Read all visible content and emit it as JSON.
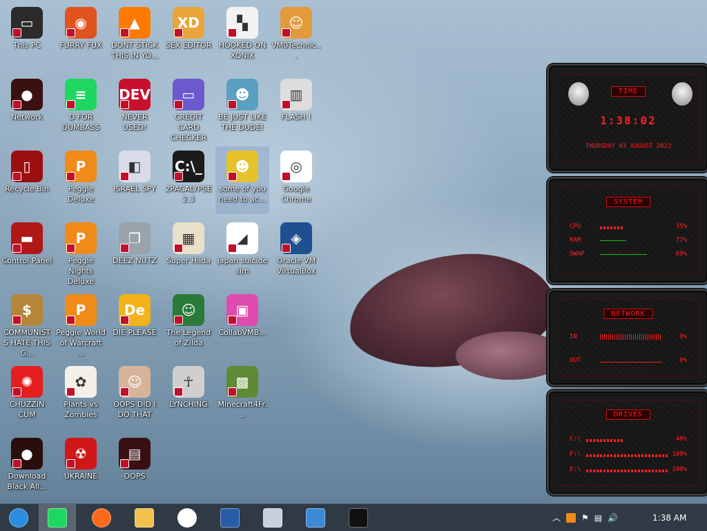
{
  "desktop": {
    "icons": [
      {
        "label": "This PC",
        "col": 0,
        "row": 0,
        "color": "#2b2b2b",
        "glyph": "▭"
      },
      {
        "label": "FURRY FUX",
        "col": 1,
        "row": 0,
        "color": "#e0531f",
        "glyph": "◉"
      },
      {
        "label": "DONT STICK THIS IN YO...",
        "col": 2,
        "row": 0,
        "color": "#ff7a00",
        "glyph": "▲"
      },
      {
        "label": "SEX EDITOR",
        "col": 3,
        "row": 0,
        "color": "#e9a53b",
        "glyph": "XD"
      },
      {
        "label": "HOOKED ON XONIX",
        "col": 4,
        "row": 0,
        "color": "#f2f2f2",
        "glyph": "▚"
      },
      {
        "label": "VM0Technic...",
        "col": 5,
        "row": 0,
        "color": "#e39a3b",
        "glyph": "☺"
      },
      {
        "label": "Network",
        "col": 0,
        "row": 1,
        "color": "#3a1010",
        "glyph": "●"
      },
      {
        "label": "D FOR DUMBASS",
        "col": 1,
        "row": 1,
        "color": "#1ed760",
        "glyph": "≡"
      },
      {
        "label": "NEVER USED!",
        "col": 2,
        "row": 1,
        "color": "#c8102e",
        "glyph": "DEV"
      },
      {
        "label": "CREDIT CARD CHECKER",
        "col": 3,
        "row": 1,
        "color": "#6a5acd",
        "glyph": "▭"
      },
      {
        "label": "BE JUST LIKE THE DUDE!",
        "col": 4,
        "row": 1,
        "color": "#5aa0c0",
        "glyph": "☻"
      },
      {
        "label": "FLASH !",
        "col": 5,
        "row": 1,
        "color": "#dddddd",
        "glyph": "▥"
      },
      {
        "label": "Recycle Bin",
        "col": 0,
        "row": 2,
        "color": "#9a1010",
        "glyph": "▯"
      },
      {
        "label": "Peggle Deluxe",
        "col": 1,
        "row": 2,
        "color": "#f08a18",
        "glyph": "P"
      },
      {
        "label": "ISRAEL SPY",
        "col": 2,
        "row": 2,
        "color": "#d8dce8",
        "glyph": "◧"
      },
      {
        "label": "2PACALYPSE 2.3",
        "col": 3,
        "row": 2,
        "color": "#1b1b1b",
        "glyph": "C:\\_"
      },
      {
        "label": "some of you need to ac...",
        "col": 4,
        "row": 2,
        "color": "#e8c22a",
        "glyph": "☻",
        "selected": true
      },
      {
        "label": "Google Chrome",
        "col": 5,
        "row": 2,
        "color": "#ffffff",
        "glyph": "◎"
      },
      {
        "label": "Control Panel",
        "col": 0,
        "row": 3,
        "color": "#b01818",
        "glyph": "▬"
      },
      {
        "label": "Peggle Nights Deluxe",
        "col": 1,
        "row": 3,
        "color": "#f08a18",
        "glyph": "P"
      },
      {
        "label": "DEEZ NUTZ",
        "col": 2,
        "row": 3,
        "color": "#9aa2aa",
        "glyph": "❐"
      },
      {
        "label": "Super Hilda",
        "col": 3,
        "row": 3,
        "color": "#e8e0c8",
        "glyph": "▦"
      },
      {
        "label": "japan suicide sim",
        "col": 4,
        "row": 3,
        "color": "#ffffff",
        "glyph": "◢"
      },
      {
        "label": "Oracle VM VirtualBox",
        "col": 5,
        "row": 3,
        "color": "#1f4f8f",
        "glyph": "◈"
      },
      {
        "label": "COMMUNISTS HATE THIS G...",
        "col": 0,
        "row": 4,
        "color": "#b5863a",
        "glyph": "$"
      },
      {
        "label": "Peggle World of Warcraft ...",
        "col": 1,
        "row": 4,
        "color": "#f08a18",
        "glyph": "P"
      },
      {
        "label": "DIE PLEASE",
        "col": 2,
        "row": 4,
        "color": "#f2b21a",
        "glyph": "De"
      },
      {
        "label": "The Legend of Zilda",
        "col": 3,
        "row": 4,
        "color": "#2a7a3a",
        "glyph": "☺"
      },
      {
        "label": "CollabVMB...",
        "col": 4,
        "row": 4,
        "color": "#e04bb0",
        "glyph": "▣"
      },
      {
        "label": "CHUZZIN CUM",
        "col": 0,
        "row": 5,
        "color": "#e51f1f",
        "glyph": "✺"
      },
      {
        "label": "Plants vs Zombies",
        "col": 1,
        "row": 5,
        "color": "#f4f0e8",
        "glyph": "✿"
      },
      {
        "label": "OOPS DID I DO THAT",
        "col": 2,
        "row": 5,
        "color": "#d6b49a",
        "glyph": "☺"
      },
      {
        "label": "LYNCHING",
        "col": 3,
        "row": 5,
        "color": "#cfcfcf",
        "glyph": "☥"
      },
      {
        "label": "Minecraft4Fr...",
        "col": 4,
        "row": 5,
        "color": "#5f8a34",
        "glyph": "▩"
      },
      {
        "label": "Download Black All...",
        "col": 0,
        "row": 6,
        "color": "#2b0d0d",
        "glyph": "●"
      },
      {
        "label": "UKRAINE",
        "col": 1,
        "row": 6,
        "color": "#d01818",
        "glyph": "☢"
      },
      {
        "label": "OOPS",
        "col": 2,
        "row": 6,
        "color": "#3a0f14",
        "glyph": "▤"
      }
    ]
  },
  "widgets": {
    "time": {
      "title": "TIME",
      "clock": "1:38:02",
      "date": "THURSDAY 03 AUGUST 2023"
    },
    "system": {
      "title": "SYSTEM",
      "rows": [
        {
          "name": "CPU",
          "value": "35%"
        },
        {
          "name": "RAM",
          "value": "77%"
        },
        {
          "name": "SWAP",
          "value": "69%"
        }
      ]
    },
    "network": {
      "title": "NETWORK",
      "rows": [
        {
          "name": "IN",
          "value": "0%"
        },
        {
          "name": "OUT",
          "value": "0%"
        }
      ]
    },
    "drives": {
      "title": "DRIVES",
      "rows": [
        {
          "name": "C:\\",
          "value": "40%"
        },
        {
          "name": "F:\\",
          "value": "100%"
        },
        {
          "name": "E:\\",
          "value": "100%"
        }
      ]
    },
    "accent": "#ff2020"
  },
  "taskbar": {
    "items": [
      {
        "name": "start-orb-icon",
        "color": "#2b8de0"
      },
      {
        "name": "spotify-icon",
        "color": "#1ed760",
        "active": true
      },
      {
        "name": "firefox-icon",
        "color": "#ff6a1a"
      },
      {
        "name": "file-explorer-icon",
        "color": "#f2c14e"
      },
      {
        "name": "chrome-icon",
        "color": "#ffffff"
      },
      {
        "name": "virtualbox-icon",
        "color": "#2a5da8"
      },
      {
        "name": "resource-monitor-icon",
        "color": "#c8d0dc"
      },
      {
        "name": "windows10-icon",
        "color": "#3a8ad6"
      },
      {
        "name": "command-prompt-icon",
        "color": "#111111"
      }
    ],
    "clock": "1:38 AM"
  }
}
